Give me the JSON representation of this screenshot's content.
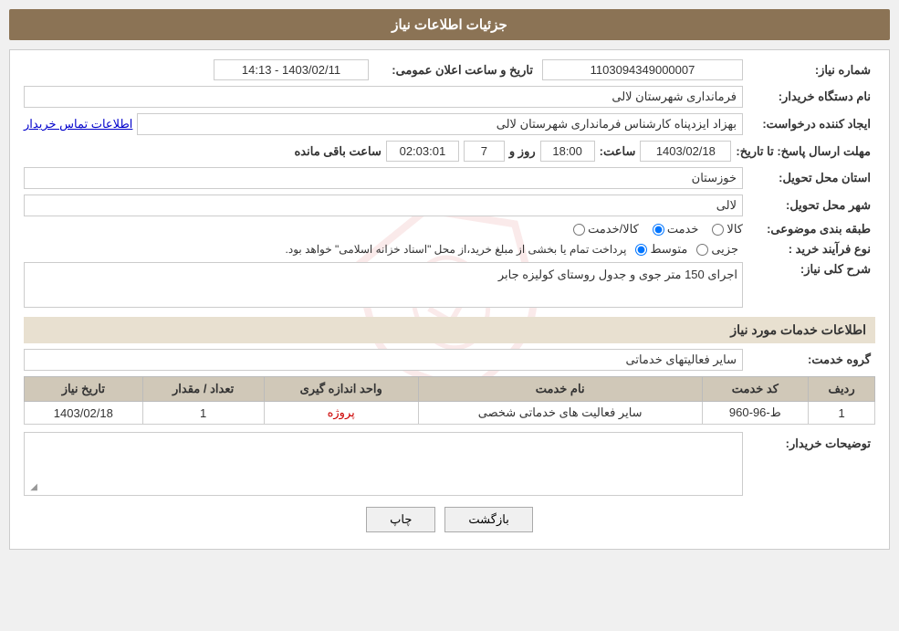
{
  "header": {
    "title": "جزئیات اطلاعات نیاز"
  },
  "form": {
    "need_number_label": "شماره نیاز:",
    "need_number_value": "1103094349000007",
    "announcement_datetime_label": "تاریخ و ساعت اعلان عمومی:",
    "announcement_datetime_value": "1403/02/11 - 14:13",
    "buyer_org_label": "نام دستگاه خریدار:",
    "buyer_org_value": "فرمانداری شهرستان لالی",
    "creator_label": "ایجاد کننده درخواست:",
    "creator_value": "بهزاد ایزدپناه کارشناس فرمانداری شهرستان لالی",
    "contact_link": "اطلاعات تماس خریدار",
    "deadline_label": "مهلت ارسال پاسخ: تا تاریخ:",
    "deadline_date": "1403/02/18",
    "deadline_time_label": "ساعت:",
    "deadline_time": "18:00",
    "deadline_days_label": "روز و",
    "deadline_days": "7",
    "remaining_time_label": "ساعت باقی مانده",
    "remaining_time": "02:03:01",
    "province_label": "استان محل تحویل:",
    "province_value": "خوزستان",
    "city_label": "شهر محل تحویل:",
    "city_value": "لالی",
    "category_label": "طبقه بندی موضوعی:",
    "category_options": [
      {
        "label": "کالا",
        "value": "goods"
      },
      {
        "label": "خدمت",
        "value": "service"
      },
      {
        "label": "کالا/خدمت",
        "value": "both"
      }
    ],
    "category_selected": "service",
    "process_label": "نوع فرآیند خرید :",
    "process_options": [
      {
        "label": "جزیی",
        "value": "partial"
      },
      {
        "label": "متوسط",
        "value": "medium"
      }
    ],
    "process_selected": "medium",
    "process_note": "پرداخت تمام یا بخشی از مبلغ خرید،از محل \"اسناد خزانه اسلامی\" خواهد بود.",
    "description_section_title": "شرح کلی نیاز:",
    "description_value": "اجرای 150 متر جوی و جدول روستای کولیزه جابر",
    "services_section_title": "اطلاعات خدمات مورد نیاز",
    "group_service_label": "گروه خدمت:",
    "group_service_value": "سایر فعالیتهای خدماتی",
    "table": {
      "columns": [
        "ردیف",
        "کد خدمت",
        "نام خدمت",
        "واحد اندازه گیری",
        "تعداد / مقدار",
        "تاریخ نیاز"
      ],
      "rows": [
        {
          "row": "1",
          "service_code": "ط-96-960",
          "service_name": "سایر فعالیت های خدماتی شخصی",
          "unit": "پروژه",
          "quantity": "1",
          "date": "1403/02/18"
        }
      ]
    },
    "buyer_notes_label": "توضیحات خریدار:",
    "buyer_notes_value": ""
  },
  "buttons": {
    "print_label": "چاپ",
    "back_label": "بازگشت"
  }
}
